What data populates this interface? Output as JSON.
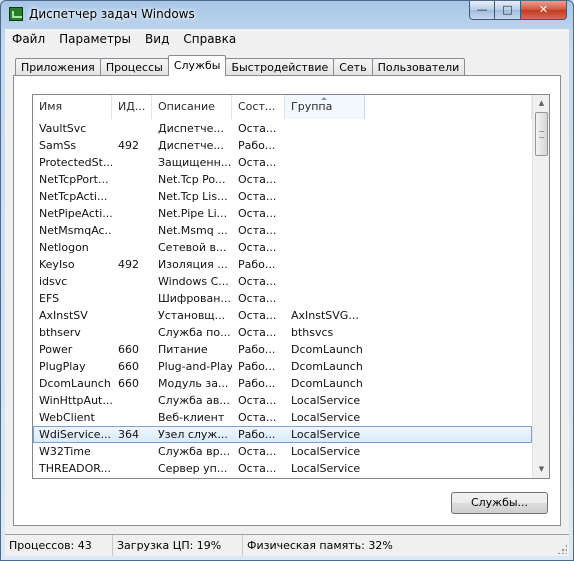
{
  "window": {
    "title": "Диспетчер задач Windows",
    "caption_buttons": {
      "minimize": "—",
      "maximize": "□",
      "close": "✕"
    }
  },
  "menu": [
    "Файл",
    "Параметры",
    "Вид",
    "Справка"
  ],
  "tabs": [
    "Приложения",
    "Процессы",
    "Службы",
    "Быстродействие",
    "Сеть",
    "Пользователи"
  ],
  "active_tab": "Службы",
  "table": {
    "columns": [
      "Имя",
      "ИД...",
      "Описание",
      "Сост...",
      "Группа"
    ],
    "sorted_column": "Группа",
    "rows": [
      [
        "VaultSvc",
        "",
        "Диспетче...",
        "Оста...",
        ""
      ],
      [
        "SamSs",
        "492",
        "Диспетче...",
        "Рабо...",
        ""
      ],
      [
        "ProtectedSt...",
        "",
        "Защищенн...",
        "Оста...",
        ""
      ],
      [
        "NetTcpPort...",
        "",
        "Net.Tcp Po...",
        "Оста...",
        ""
      ],
      [
        "NetTcpActi...",
        "",
        "Net.Tcp Lis...",
        "Оста...",
        ""
      ],
      [
        "NetPipeActi...",
        "",
        "Net.Pipe Li...",
        "Оста...",
        ""
      ],
      [
        "NetMsmqAc...",
        "",
        "Net.Msmq ...",
        "Оста...",
        ""
      ],
      [
        "Netlogon",
        "",
        "Сетевой в...",
        "Оста...",
        ""
      ],
      [
        "KeyIso",
        "492",
        "Изоляция ...",
        "Рабо...",
        ""
      ],
      [
        "idsvc",
        "",
        "Windows C...",
        "Оста...",
        ""
      ],
      [
        "EFS",
        "",
        "Шифрован...",
        "Оста...",
        ""
      ],
      [
        "AxInstSV",
        "",
        "Установщ...",
        "Оста...",
        "AxInstSVG..."
      ],
      [
        "bthserv",
        "",
        "Служба по...",
        "Оста...",
        "bthsvcs"
      ],
      [
        "Power",
        "660",
        "Питание",
        "Рабо...",
        "DcomLaunch"
      ],
      [
        "PlugPlay",
        "660",
        "Plug-and-Play",
        "Рабо...",
        "DcomLaunch"
      ],
      [
        "DcomLaunch",
        "660",
        "Модуль за...",
        "Рабо...",
        "DcomLaunch"
      ],
      [
        "WinHttpAut...",
        "",
        "Служба ав...",
        "Оста...",
        "LocalService"
      ],
      [
        "WebClient",
        "",
        "Веб-клиент",
        "Оста...",
        "LocalService"
      ],
      [
        "WdiService...",
        "364",
        "Узел служ...",
        "Рабо...",
        "LocalService"
      ],
      [
        "W32Time",
        "",
        "Служба вр...",
        "Оста...",
        "LocalService"
      ],
      [
        "THREADOR...",
        "",
        "Сервер уп...",
        "Оста...",
        "LocalService"
      ],
      [
        "...",
        "",
        "...",
        "",
        ""
      ]
    ],
    "selected_row_index": 18
  },
  "services_button": "Службы...",
  "status": {
    "processes": "Процессов: 43",
    "cpu": "Загрузка ЦП: 19%",
    "memory": "Физическая память: 32%"
  },
  "colors": {
    "selection_fill": "#d6e9fb",
    "selection_border": "#7da2ce",
    "frame": "#a7c7e8"
  }
}
